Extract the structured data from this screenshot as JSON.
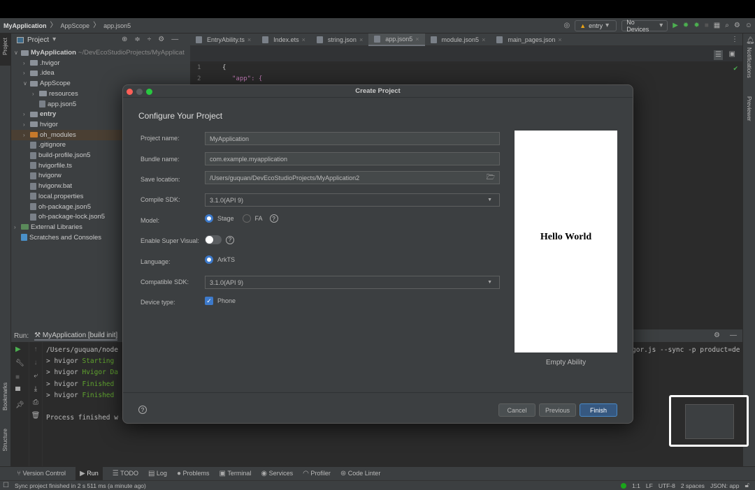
{
  "breadcrumb": [
    "MyApplication",
    "AppScope",
    "app.json5"
  ],
  "toolbar": {
    "run_config": "entry",
    "device": "No Devices"
  },
  "left_strip": {
    "project": "Project",
    "bookmarks": "Bookmarks",
    "structure": "Structure"
  },
  "right_strip": {
    "notifications": "Notifications",
    "previewer": "Previewer"
  },
  "project_panel": {
    "title": "Project",
    "tree": [
      {
        "label": "MyApplication",
        "path": "~/DevEcoStudioProjects/MyApplicat",
        "depth": 0,
        "type": "module",
        "open": true
      },
      {
        "label": ".hvigor",
        "depth": 1,
        "type": "folder",
        "open": false
      },
      {
        "label": ".idea",
        "depth": 1,
        "type": "folder",
        "open": false
      },
      {
        "label": "AppScope",
        "depth": 1,
        "type": "folder",
        "open": true
      },
      {
        "label": "resources",
        "depth": 2,
        "type": "folder",
        "open": false
      },
      {
        "label": "app.json5",
        "depth": 2,
        "type": "file"
      },
      {
        "label": "entry",
        "depth": 1,
        "type": "folder",
        "open": false,
        "bold": true
      },
      {
        "label": "hvigor",
        "depth": 1,
        "type": "folder",
        "open": false
      },
      {
        "label": "oh_modules",
        "depth": 1,
        "type": "folder-orange",
        "open": false,
        "highlight": true
      },
      {
        "label": ".gitignore",
        "depth": 1,
        "type": "file"
      },
      {
        "label": "build-profile.json5",
        "depth": 1,
        "type": "file"
      },
      {
        "label": "hvigorfile.ts",
        "depth": 1,
        "type": "file"
      },
      {
        "label": "hvigorw",
        "depth": 1,
        "type": "file"
      },
      {
        "label": "hvigorw.bat",
        "depth": 1,
        "type": "file"
      },
      {
        "label": "local.properties",
        "depth": 1,
        "type": "file"
      },
      {
        "label": "oh-package.json5",
        "depth": 1,
        "type": "file"
      },
      {
        "label": "oh-package-lock.json5",
        "depth": 1,
        "type": "file"
      },
      {
        "label": "External Libraries",
        "depth": 0,
        "type": "lib",
        "open": false
      },
      {
        "label": "Scratches and Consoles",
        "depth": 0,
        "type": "scratch"
      }
    ]
  },
  "editor": {
    "tabs": [
      {
        "label": "EntryAbility.ts"
      },
      {
        "label": "Index.ets"
      },
      {
        "label": "string.json"
      },
      {
        "label": "app.json5",
        "active": true
      },
      {
        "label": "module.json5"
      },
      {
        "label": "main_pages.json"
      }
    ],
    "lines": [
      {
        "n": "1",
        "code": "{"
      },
      {
        "n": "2",
        "code": "\"app\": {"
      }
    ]
  },
  "run_panel": {
    "label": "Run:",
    "tab": "MyApplication [build init]",
    "lines": [
      {
        "prefix": "/Users/guquan/node",
        "green": ""
      },
      {
        "prefix": "> hvigor ",
        "green": "Starting "
      },
      {
        "prefix": "> hvigor ",
        "green": "Hvigor Da"
      },
      {
        "prefix": "> hvigor ",
        "green": "Finished "
      },
      {
        "prefix": "> hvigor ",
        "green": "Finished "
      },
      {
        "prefix": "",
        "green": ""
      },
      {
        "prefix": "Process finished w",
        "green": ""
      }
    ],
    "right_text": "gor.js --sync -p product=de"
  },
  "dialog": {
    "title": "Create Project",
    "heading": "Configure Your Project",
    "fields": {
      "project_name_label": "Project name:",
      "project_name": "MyApplication",
      "bundle_name_label": "Bundle name:",
      "bundle_name": "com.example.myapplication",
      "save_location_label": "Save location:",
      "save_location": "/Users/guquan/DevEcoStudioProjects/MyApplication2",
      "compile_sdk_label": "Compile SDK:",
      "compile_sdk": "3.1.0(API 9)",
      "model_label": "Model:",
      "model_options": [
        "Stage",
        "FA"
      ],
      "model_selected": "Stage",
      "super_visual_label": "Enable Super Visual:",
      "super_visual_on": false,
      "language_label": "Language:",
      "language": "ArkTS",
      "compatible_sdk_label": "Compatible SDK:",
      "compatible_sdk": "3.1.0(API 9)",
      "device_type_label": "Device type:",
      "device_type": "Phone",
      "device_checked": true
    },
    "preview_text": "Hello World",
    "template_name": "Empty Ability",
    "buttons": {
      "cancel": "Cancel",
      "previous": "Previous",
      "finish": "Finish"
    },
    "accent": "#3d7acb"
  },
  "bottom_tabs": [
    "Version Control",
    "Run",
    "TODO",
    "Log",
    "Problems",
    "Terminal",
    "Services",
    "Profiler",
    "Code Linter"
  ],
  "status": {
    "message": "Sync project finished in 2 s 511 ms (a minute ago)",
    "position": "1:1",
    "line_sep": "LF",
    "encoding": "UTF-8",
    "indent": "2 spaces",
    "file_type": "JSON: app"
  }
}
